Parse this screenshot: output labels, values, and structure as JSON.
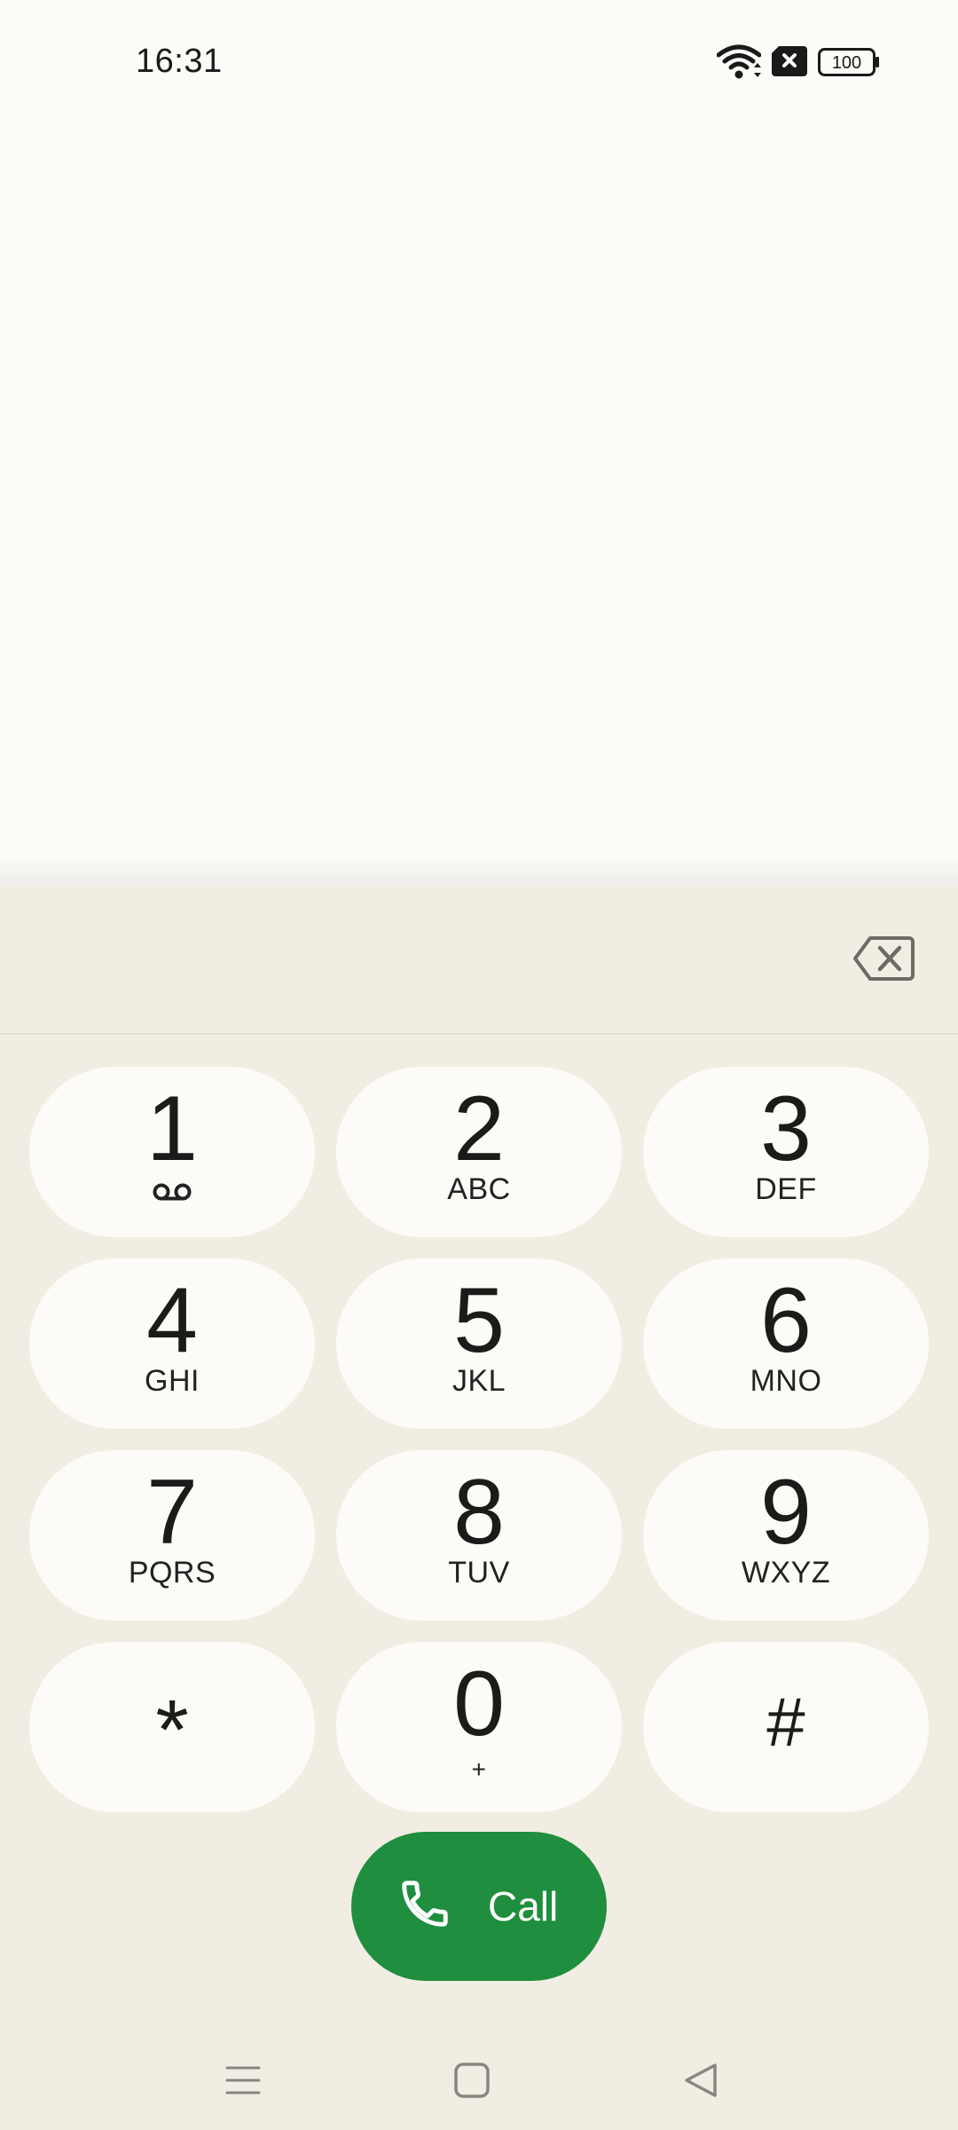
{
  "status_bar": {
    "time": "16:31",
    "battery": "100",
    "icons": [
      "wifi-icon",
      "no-sim-icon",
      "battery-icon"
    ]
  },
  "dialer": {
    "entered_number": "",
    "keys": [
      {
        "digit": "1",
        "letters": "",
        "icon": "voicemail-icon"
      },
      {
        "digit": "2",
        "letters": "ABC"
      },
      {
        "digit": "3",
        "letters": "DEF"
      },
      {
        "digit": "4",
        "letters": "GHI"
      },
      {
        "digit": "5",
        "letters": "JKL"
      },
      {
        "digit": "6",
        "letters": "MNO"
      },
      {
        "digit": "7",
        "letters": "PQRS"
      },
      {
        "digit": "8",
        "letters": "TUV"
      },
      {
        "digit": "9",
        "letters": "WXYZ"
      },
      {
        "digit": "*",
        "letters": ""
      },
      {
        "digit": "0",
        "letters": "+"
      },
      {
        "digit": "#",
        "letters": ""
      }
    ],
    "call_label": "Call"
  },
  "nav_bar": {
    "buttons": [
      "menu-icon",
      "home-icon",
      "back-icon"
    ]
  },
  "colors": {
    "background": "#FDFBF7",
    "panel": "#F2EDE3",
    "key": "#FDFBF7",
    "call_button": "#1F8E3E"
  }
}
